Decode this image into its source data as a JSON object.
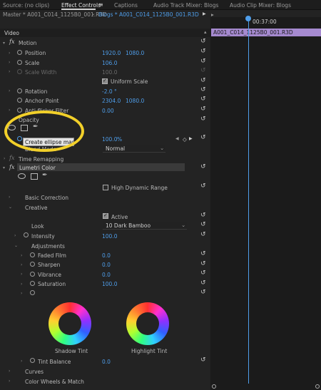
{
  "tabs": [
    {
      "label": "Source: (no clips)",
      "active": false
    },
    {
      "label": "Effect Controls",
      "active": true
    },
    {
      "label": "Captions",
      "active": false
    },
    {
      "label": "Audio Track Mixer: Blogs",
      "active": false
    },
    {
      "label": "Audio Clip Mixer: Blogs",
      "active": false
    }
  ],
  "menu_icon": "hamburger-icon",
  "clip_header": {
    "master": "Master * A001_C014_1125B0_001.R3D",
    "sequence": "Blogs * A001_C014_1125B0_001.R3D",
    "timecode": "00:37:00",
    "clip_name": "A001_C014_1125B0_001.R3D"
  },
  "section_video": "Video",
  "motion": {
    "label": "Motion",
    "position": {
      "label": "Position",
      "x": "1920.0",
      "y": "1080.0"
    },
    "scale": {
      "label": "Scale",
      "value": "106.0"
    },
    "scale_width": {
      "label": "Scale Width",
      "value": "100.0"
    },
    "uniform_scale": "Uniform Scale",
    "rotation": {
      "label": "Rotation",
      "value": "-2.0 °"
    },
    "anchor_point": {
      "label": "Anchor Point",
      "x": "2304.0",
      "y": "1080.0"
    },
    "anti_flicker": {
      "label": "Anti-flicker Filter",
      "value": "0.00"
    }
  },
  "opacity": {
    "label": "Opacity",
    "tooltip": "Create ellipse mask",
    "value": "100.0",
    "unit": "%",
    "keyframe_value": "0",
    "blend_mode_label": "Blend Mode",
    "blend_mode_value": "Normal"
  },
  "time_remapping": "Time Remapping",
  "lumetri": {
    "label": "Lumetri Color",
    "hdr": "High Dynamic Range",
    "basic_correction": "Basic Correction",
    "creative": "Creative",
    "active": "Active",
    "look_label": "Look",
    "look_value": "10 Dark Bamboo",
    "intensity": {
      "label": "Intensity",
      "value": "100.0"
    },
    "adjustments": "Adjustments",
    "faded_film": {
      "label": "Faded Film",
      "value": "0.0"
    },
    "sharpen": {
      "label": "Sharpen",
      "value": "0.0"
    },
    "vibrance": {
      "label": "Vibrance",
      "value": "0.0"
    },
    "saturation": {
      "label": "Saturation",
      "value": "100.0"
    },
    "shadow_tint": "Shadow Tint",
    "highlight_tint": "Highlight Tint",
    "tint_balance": {
      "label": "Tint Balance",
      "value": "0.0"
    },
    "curves": "Curves",
    "color_wheels": "Color Wheels & Match"
  },
  "colors": {
    "accent": "#4f9eea",
    "highlight_ring": "#f2d02a",
    "clip_bar": "#a68ad0"
  }
}
